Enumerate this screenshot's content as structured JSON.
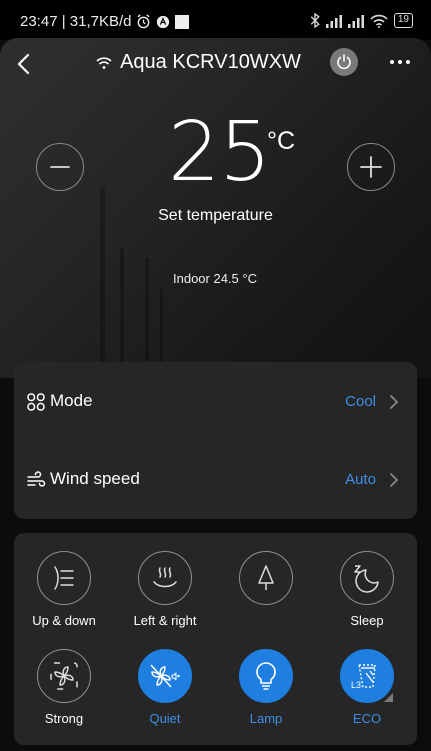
{
  "status_bar": {
    "time_and_speed": "23:47 | 31,7KB/d",
    "battery": "19"
  },
  "header": {
    "title": "Aqua KCRV10WXW"
  },
  "temperature": {
    "value": "25",
    "unit": "°C",
    "set_label": "Set temperature",
    "indoor_text": "Indoor 24.5 °C"
  },
  "settings": {
    "mode": {
      "label": "Mode",
      "value": "Cool"
    },
    "wind_speed": {
      "label": "Wind speed",
      "value": "Auto"
    }
  },
  "functions": [
    {
      "label": "Up & down",
      "icon": "up-down-swing-icon",
      "active": false
    },
    {
      "label": "Left & right",
      "icon": "left-right-swing-icon",
      "active": false
    },
    {
      "label": "",
      "icon": "tree-icon",
      "active": false
    },
    {
      "label": "Sleep",
      "icon": "moon-icon",
      "active": false
    },
    {
      "label": "Strong",
      "icon": "fan-icon",
      "active": false
    },
    {
      "label": "Quiet",
      "icon": "quiet-fan-icon",
      "active": true
    },
    {
      "label": "Lamp",
      "icon": "bulb-icon",
      "active": true
    },
    {
      "label": "ECO",
      "icon": "eco-icon",
      "active": true,
      "level": "L3"
    }
  ],
  "colors": {
    "accent": "#1e7fe0",
    "accent_text": "#3d8fe6",
    "card": "#262626",
    "background": "#0c0c0c"
  }
}
